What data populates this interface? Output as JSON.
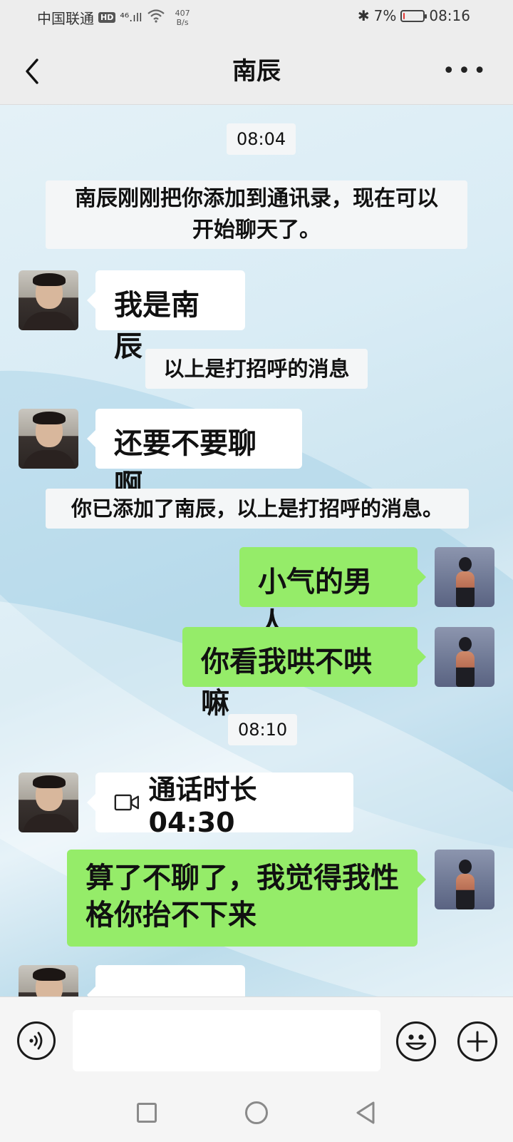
{
  "status_bar": {
    "carrier": "中国联通",
    "hd": "HD",
    "signal": "⁴⁶.ıll",
    "speed_value": "407",
    "speed_unit": "B/s",
    "bluetooth": "✱",
    "battery_text": "7%",
    "battery_level": 0.07,
    "battery_color": "#e53935",
    "time": "08:16"
  },
  "header": {
    "title": "南辰",
    "back_icon": "chevron-left-icon",
    "more_icon": "more-icon",
    "more_glyph": "•••"
  },
  "messages": {
    "ts1": "08:04",
    "sys1_line1": "南辰刚刚把你添加到通讯录，现在可以",
    "sys1_line2": "开始聊天了。",
    "m1": "我是南辰",
    "sys2": "以上是打招呼的消息",
    "m2": "还要不要聊啊",
    "sys3": "你已添加了南辰，以上是打招呼的消息。",
    "m3": "小气的男人",
    "m4": "你看我哄不哄嘛",
    "ts2": "08:10",
    "call_label": "通话时长 04:30",
    "m5_line1": "算了不聊了，我觉得我性",
    "m5_line2": "格你抬不下来"
  },
  "input_bar": {
    "voice_icon": "voice-icon",
    "emoji_icon": "emoji-icon",
    "plus_icon": "plus-icon",
    "text_value": ""
  },
  "nav_bar": {
    "recent_icon": "square-icon",
    "home_icon": "circle-icon",
    "back_icon": "triangle-back-icon"
  },
  "colors": {
    "incoming_bubble": "#ffffff",
    "outgoing_bubble": "#95ec69",
    "header_bg": "#ededed"
  }
}
